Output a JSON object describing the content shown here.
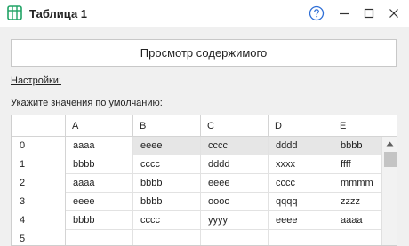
{
  "window": {
    "title": "Таблица 1"
  },
  "icons": {
    "app": "table-icon",
    "help": "question-circle-icon",
    "minimize": "minimize-icon",
    "maximize": "maximize-icon",
    "close": "close-icon",
    "scroll_up": "scroll-up-arrow-icon"
  },
  "colors": {
    "accent_blue": "#2f6fd6",
    "app_icon_green": "#21a366",
    "selected_cell": "#e6e6e6"
  },
  "preview_button": {
    "label": "Просмотр содержимого"
  },
  "settings_link": {
    "label": "Настройки:"
  },
  "defaults_label": {
    "text": "Укажите значения по умолчанию:"
  },
  "table": {
    "columns": [
      "A",
      "B",
      "C",
      "D",
      "E"
    ],
    "row_numbers": [
      "0",
      "1",
      "2",
      "3",
      "4",
      "5"
    ],
    "rows": [
      [
        "aaaa",
        "eeee",
        "cccc",
        "dddd",
        "bbbb"
      ],
      [
        "bbbb",
        "cccc",
        "dddd",
        "xxxx",
        "ffff"
      ],
      [
        "aaaa",
        "bbbb",
        "eeee",
        "cccc",
        "mmmm"
      ],
      [
        "eeee",
        "bbbb",
        "oooo",
        "qqqq",
        "zzzz"
      ],
      [
        "bbbb",
        "cccc",
        "yyyy",
        "eeee",
        "aaaa"
      ],
      [
        "",
        "",
        "",
        "",
        ""
      ]
    ]
  }
}
